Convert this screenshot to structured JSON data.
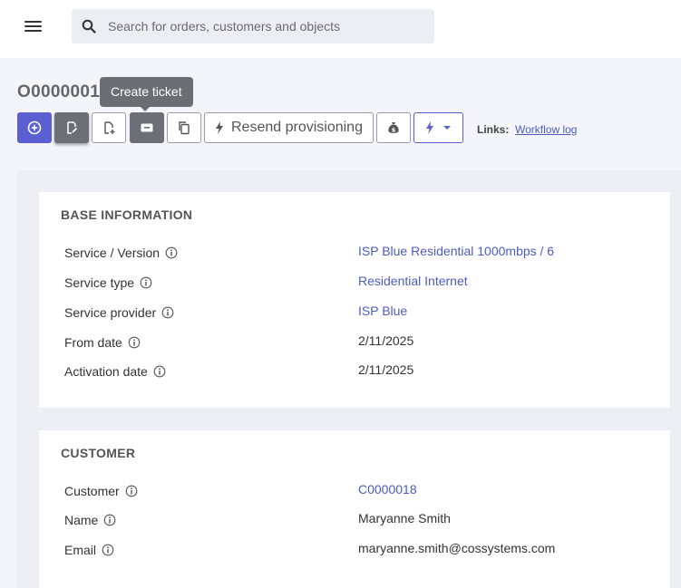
{
  "search": {
    "placeholder": "Search for orders, customers and objects",
    "value": ""
  },
  "header": {
    "order_id": "O0000001",
    "tooltip": "Create ticket",
    "resend_label": "Resend provisioning",
    "links_label": "Links:",
    "workflow_log": "Workflow log"
  },
  "base_information": {
    "title": "BASE INFORMATION",
    "rows": [
      {
        "label": "Service / Version",
        "value": "ISP Blue Residential 1000mbps / 6",
        "link": true
      },
      {
        "label": "Service type",
        "value": "Residential Internet",
        "link": true
      },
      {
        "label": "Service provider",
        "value": "ISP Blue",
        "link": true
      },
      {
        "label": "From date",
        "value": "2/11/2025",
        "link": false
      },
      {
        "label": "Activation date",
        "value": "2/11/2025",
        "link": false
      }
    ]
  },
  "customer": {
    "title": "CUSTOMER",
    "rows": [
      {
        "label": "Customer",
        "value": "C0000018",
        "link": true
      },
      {
        "label": "Name",
        "value": "Maryanne Smith",
        "link": false
      },
      {
        "label": "Email",
        "value": "maryanne.smith@cossystems.com",
        "link": false
      }
    ]
  },
  "colors": {
    "accent": "#5a5fd1",
    "link": "#4f5bbf",
    "dark_button": "#6c6f76",
    "tooltip": "#6b6e73"
  },
  "icons": [
    "menu-icon",
    "search-icon",
    "plus-circle-icon",
    "edit-document-icon",
    "document-add-icon",
    "ticket-icon",
    "copy-icon",
    "lightning-icon",
    "money-bag-icon",
    "chevron-down-icon",
    "info-icon"
  ]
}
